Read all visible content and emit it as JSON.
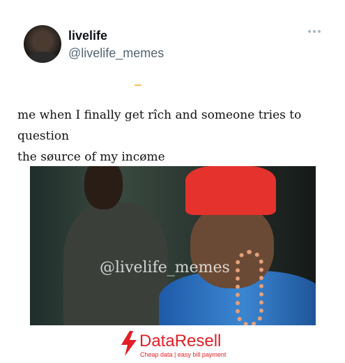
{
  "post": {
    "display_name": "livelife",
    "handle": "@livelife_memes",
    "text_line1": "me when I finally get rîch and someone tries to question",
    "text_line2": "the søurce of my incøme"
  },
  "media": {
    "watermark": "@livelife_memes"
  },
  "footer": {
    "brand": "DataResell",
    "tagline": "Cheap data | easy bill payment",
    "brand_color": "#e11f26"
  },
  "icons": {
    "more": "more-options-icon",
    "logo": "lightning-bolt-icon"
  }
}
